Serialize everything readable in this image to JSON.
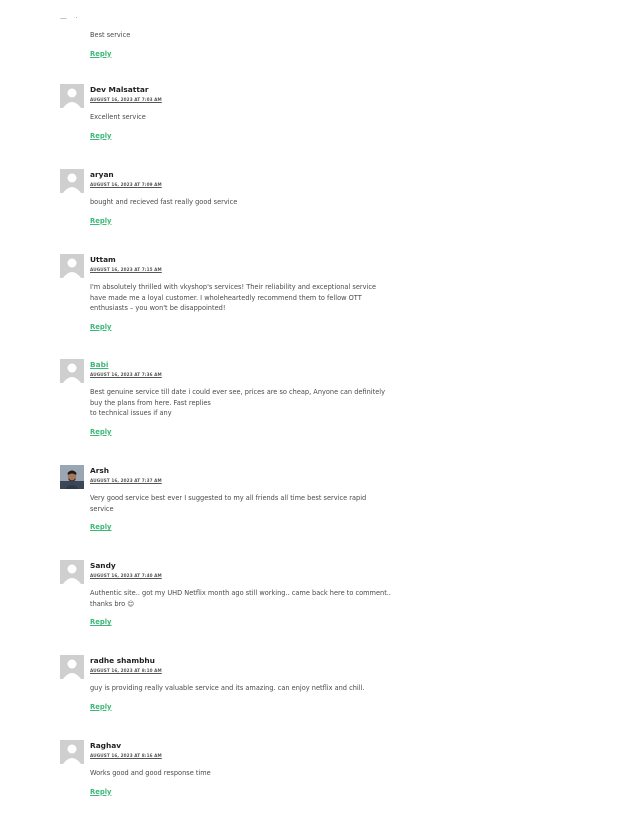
{
  "first": {
    "text": "Best service",
    "reply_label": "Reply"
  },
  "comments": [
    {
      "author": "Dev Malsattar",
      "date": "AUGUST 16, 2023 AT 7:03 AM",
      "text": "Excellent service",
      "reply_label": "Reply"
    },
    {
      "author": "aryan",
      "date": "AUGUST 16, 2023 AT 7:09 AM",
      "text": "bought and recieved fast really good service",
      "reply_label": "Reply"
    },
    {
      "author": "Uttam",
      "date": "AUGUST 16, 2023 AT 7:15 AM",
      "text": "I'm absolutely thrilled with vkyshop's services! Their reliability and exceptional service\nhave made me a loyal customer. I wholeheartedly recommend them to fellow OTT\nenthusiasts – you won't be disappointed!",
      "reply_label": "Reply"
    },
    {
      "author": "Babi",
      "date": "AUGUST 16, 2023 AT 7:36 AM",
      "text": "Best genuine service till date i could ever see, prices are so cheap, Anyone can definitely\nbuy the plans from here. Fast replies\nto technical issues if any",
      "reply_label": "Reply"
    },
    {
      "author": "Arsh",
      "date": "AUGUST 16, 2023 AT 7:37 AM",
      "text": "Very good service best ever I suggested to my all friends all time best service rapid\nservice",
      "reply_label": "Reply"
    },
    {
      "author": "Sandy",
      "date": "AUGUST 16, 2023 AT 7:40 AM",
      "text": "Authentic site.. got my UHD Netflix month ago still working.. came back here to comment..\nthanks bro 😊",
      "reply_label": "Reply"
    },
    {
      "author": "radhe shambhu",
      "date": "AUGUST 16, 2023 AT 8:10 AM",
      "text": "guy is providing really valuable service and its amazing. can enjoy netflix and chill.",
      "reply_label": "Reply"
    },
    {
      "author": "Raghav",
      "date": "AUGUST 16, 2023 AT 8:16 AM",
      "text": "Works good and good response time",
      "reply_label": "Reply"
    }
  ]
}
